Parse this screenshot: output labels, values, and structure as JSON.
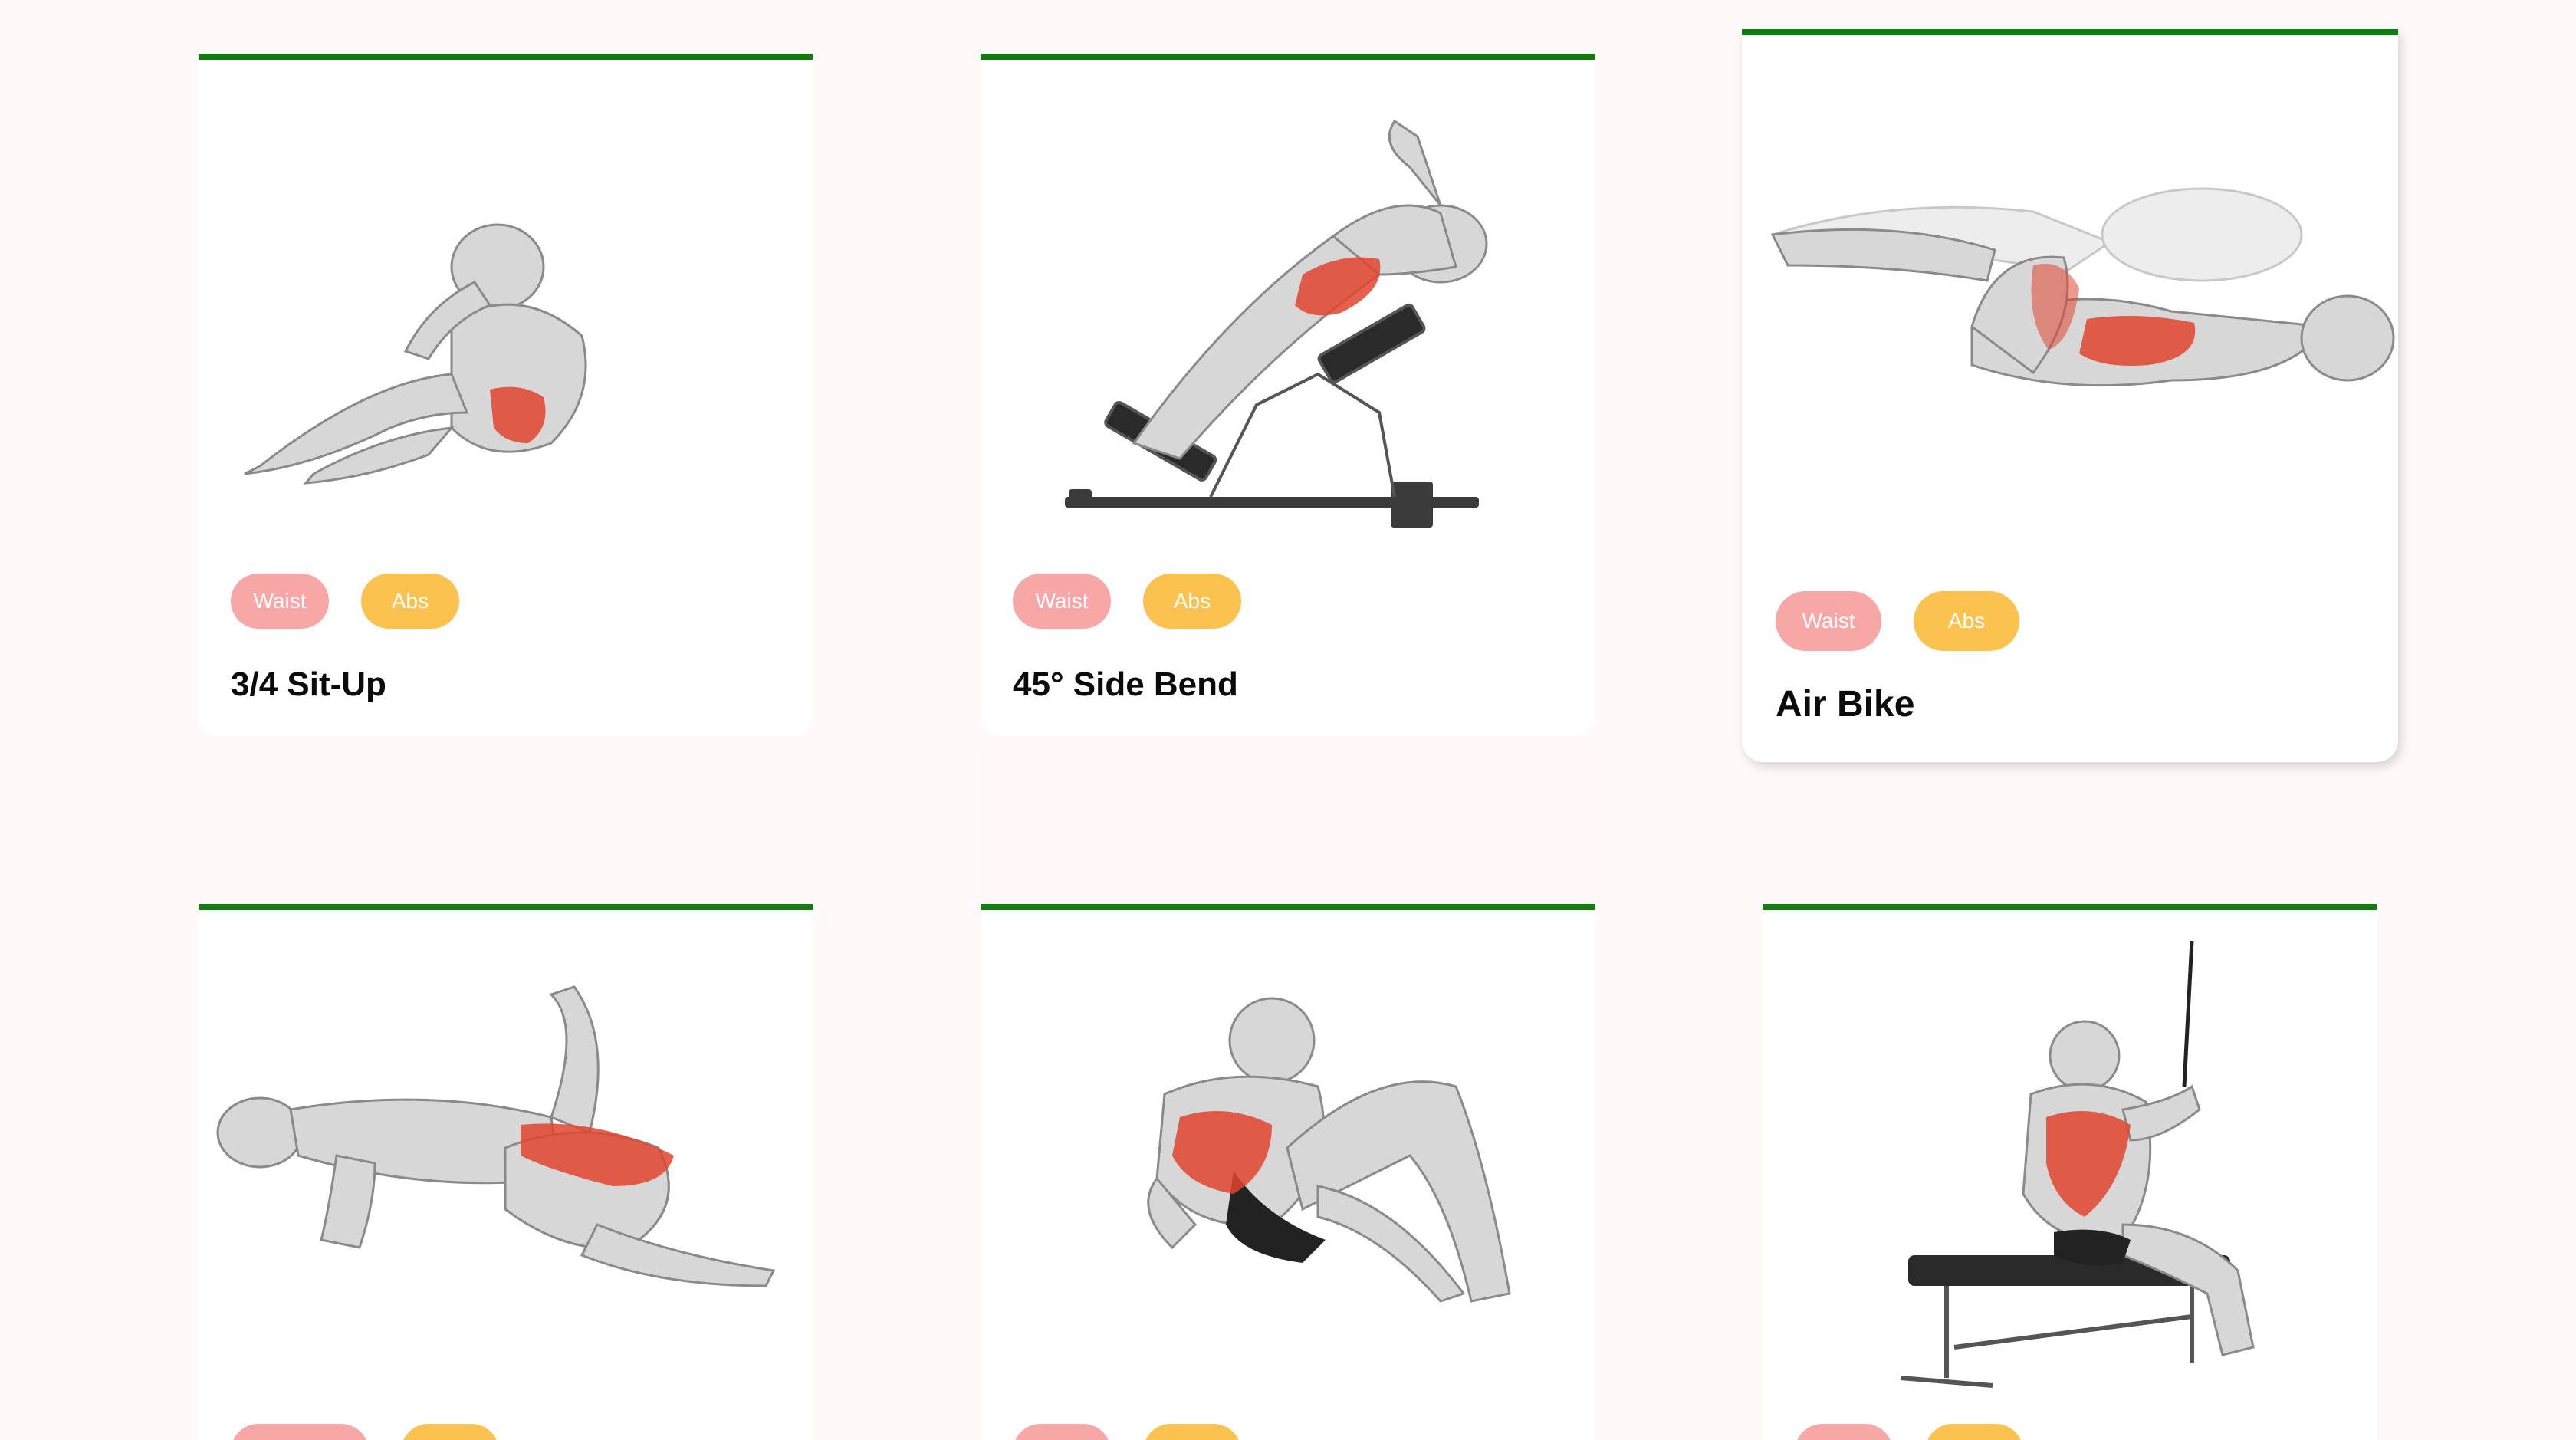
{
  "colors": {
    "page_bg": "#fffafa",
    "card_bg": "#ffffff",
    "card_top_border": "#127c12",
    "tag_waist": "#f8a7a7",
    "tag_abs": "#fcc24f",
    "muscle_highlight": "#e0452f",
    "figure_gray": "#c8c8c8"
  },
  "exercises": [
    {
      "name": "3/4 Sit-Up",
      "tags": [
        "Waist",
        "Abs"
      ],
      "illustration": "sit-up-figure"
    },
    {
      "name": "45° Side Bend",
      "tags": [
        "Waist",
        "Abs"
      ],
      "illustration": "side-bend-bench-figure"
    },
    {
      "name": "Air Bike",
      "tags": [
        "Waist",
        "Abs"
      ],
      "illustration": "air-bike-figure",
      "state": "hovered"
    },
    {
      "name": "",
      "tags": [
        "",
        ""
      ],
      "illustration": "kneeling-hip-flexor-figure"
    },
    {
      "name": "",
      "tags": [
        "",
        ""
      ],
      "illustration": "seated-crunch-figure"
    },
    {
      "name": "",
      "tags": [
        "",
        ""
      ],
      "illustration": "seated-cable-row-bench-figure"
    }
  ]
}
